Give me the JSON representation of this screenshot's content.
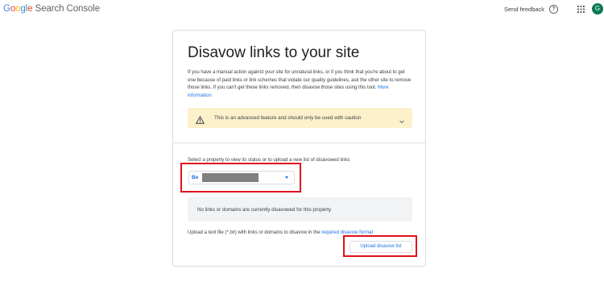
{
  "header": {
    "logo_google": [
      "G",
      "o",
      "o",
      "g",
      "l",
      "e"
    ],
    "logo_product": "Search Console",
    "send_feedback": "Send feedback",
    "help_icon": "help-circle-icon",
    "apps_icon": "apps-grid-icon",
    "avatar_initial": "G"
  },
  "main": {
    "title": "Disavow links to your site",
    "intro": "If you have a manual action against your site for unnatural links, or if you think that you're about to get one because of paid links or link schemes that violate our quality guidelines, ask the other site to remove those links. If you can't get these links removed, then disavow those sites using this tool.",
    "more_information_link": "More information",
    "warning": {
      "icon": "warning-icon",
      "text": "This is an advanced feature and should only be used with caution",
      "chevron": "chevron-down-icon"
    },
    "select_label": "Select a property to view its status or to upload a new list of disavowed links",
    "property": {
      "icon_text": "Be",
      "name_redacted": true
    },
    "empty_state": "No links or domains are currently disavowed for this property",
    "upload_info_prefix": "Upload a text file (*.txt) with links or domains to disavow in the",
    "upload_info_link": "required disavow format",
    "upload_button": "Upload disavow list"
  },
  "colors": {
    "google_blue": "#4285F4",
    "google_red": "#EA4335",
    "google_yellow": "#FBBC05",
    "google_green": "#34A853",
    "link": "#1a73e8",
    "warning_bg": "#fdf1cc",
    "highlight": "#e0101a",
    "avatar": "#0b7a53"
  }
}
